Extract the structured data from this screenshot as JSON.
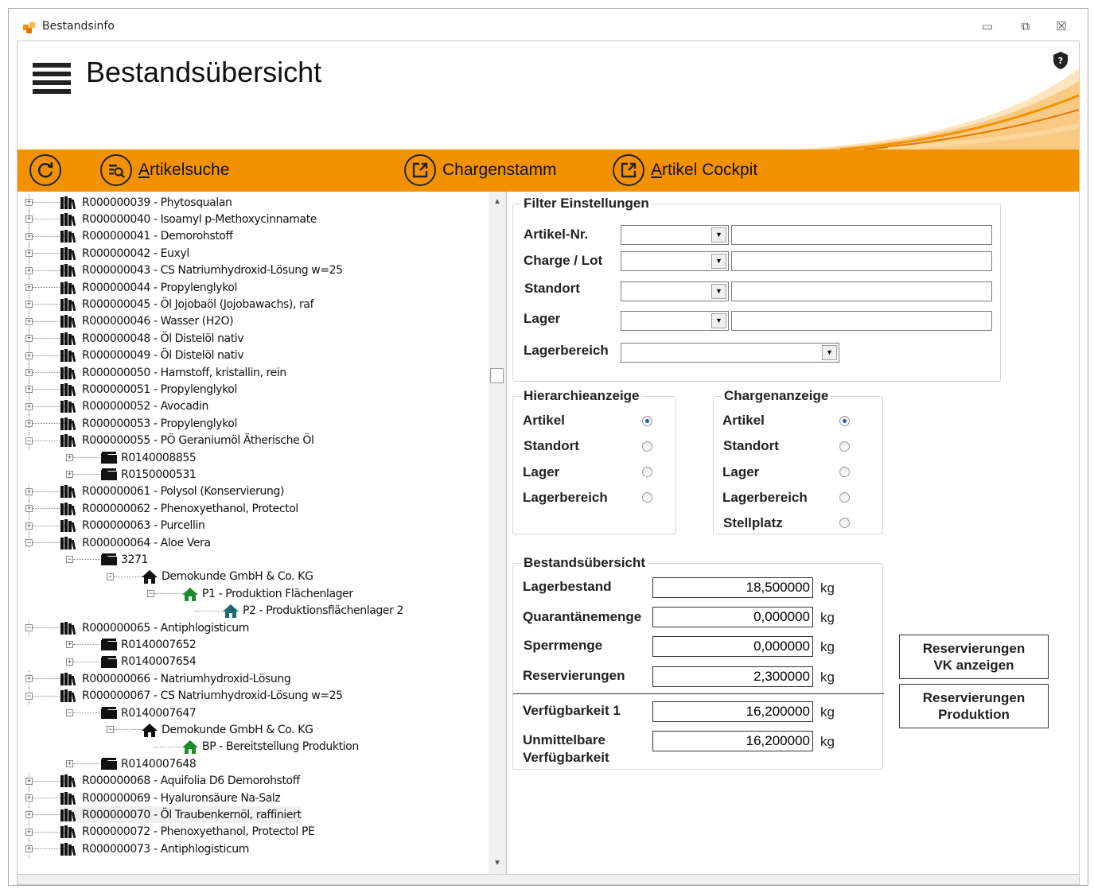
{
  "window": {
    "title": "Bestandsinfo",
    "min_glyph": "▭",
    "max_glyph": "⧉",
    "close_glyph": "☒"
  },
  "header": {
    "title": "Bestandsübersicht"
  },
  "toolbar": {
    "accent_color": "#f39200",
    "items": [
      {
        "id": "refresh",
        "label": "",
        "icon": "refresh-icon"
      },
      {
        "id": "artikelsuche",
        "label_ul": "A",
        "label_rest": "rtikelsuche",
        "icon": "search-list-icon"
      },
      {
        "id": "chargenstamm",
        "label": "Chargenstamm",
        "icon": "external-link-icon"
      },
      {
        "id": "cockpit",
        "label_ul": "A",
        "label_rest": "rtikel Cockpit",
        "icon": "external-link-icon"
      }
    ]
  },
  "tree": {
    "rows": [
      {
        "level": 0,
        "expander": "+",
        "icon": "books",
        "text": "R000000039 - Phytosqualan"
      },
      {
        "level": 0,
        "expander": "+",
        "icon": "books",
        "text": "R000000040 - Isoamyl p-Methoxycinnamate"
      },
      {
        "level": 0,
        "expander": "+",
        "icon": "books",
        "text": "R000000041 - Demorohstoff"
      },
      {
        "level": 0,
        "expander": "+",
        "icon": "books",
        "text": "R000000042 - Euxyl"
      },
      {
        "level": 0,
        "expander": "+",
        "icon": "books",
        "text": "R000000043 - CS Natriumhydroxid-Lösung w=25"
      },
      {
        "level": 0,
        "expander": "+",
        "icon": "books",
        "text": "R000000044 - Propylenglykol"
      },
      {
        "level": 0,
        "expander": "+",
        "icon": "books",
        "text": "R000000045 - Öl Jojobaöl (Jojobawachs), raf"
      },
      {
        "level": 0,
        "expander": "+",
        "icon": "books",
        "text": "R000000046 - Wasser (H2O)"
      },
      {
        "level": 0,
        "expander": "+",
        "icon": "books",
        "text": "R000000048 - Öl Distelöl nativ"
      },
      {
        "level": 0,
        "expander": "+",
        "icon": "books",
        "text": "R000000049 - Öl Distelöl nativ"
      },
      {
        "level": 0,
        "expander": "+",
        "icon": "books",
        "text": "R000000050 - Harnstoff, kristallin, rein"
      },
      {
        "level": 0,
        "expander": "+",
        "icon": "books",
        "text": "R000000051 - Propylenglykol"
      },
      {
        "level": 0,
        "expander": "+",
        "icon": "books",
        "text": "R000000052 - Avocadin"
      },
      {
        "level": 0,
        "expander": "+",
        "icon": "books",
        "text": "R000000053 - Propylenglykol"
      },
      {
        "level": 0,
        "expander": "-",
        "icon": "books",
        "text": "R000000055 - PÖ Geraniumöl Ätherische Öl"
      },
      {
        "level": 1,
        "expander": "+",
        "icon": "folder",
        "text": "R0140008855"
      },
      {
        "level": 1,
        "expander": "+",
        "icon": "folder",
        "text": "R0150000531"
      },
      {
        "level": 0,
        "expander": "+",
        "icon": "books",
        "text": "R000000061 - Polysol (Konservierung)"
      },
      {
        "level": 0,
        "expander": "+",
        "icon": "books",
        "text": "R000000062 - Phenoxyethanol, Protectol"
      },
      {
        "level": 0,
        "expander": "+",
        "icon": "books",
        "text": "R000000063 - Purcellin"
      },
      {
        "level": 0,
        "expander": "-",
        "icon": "books",
        "text": "R000000064 - Aloe Vera"
      },
      {
        "level": 1,
        "expander": "-",
        "icon": "folder",
        "text": "3271"
      },
      {
        "level": 2,
        "expander": "-",
        "icon": "house-black",
        "text": "Demokunde GmbH & Co. KG"
      },
      {
        "level": 3,
        "expander": "-",
        "icon": "house-green",
        "text": "P1 - Produktion Flächenlager"
      },
      {
        "level": 4,
        "expander": "",
        "icon": "house-teal",
        "text": "P2 - Produktionsflächenlager 2"
      },
      {
        "level": 0,
        "expander": "-",
        "icon": "books",
        "text": "R000000065 - Antiphlogisticum"
      },
      {
        "level": 1,
        "expander": "+",
        "icon": "folder",
        "text": "R0140007652"
      },
      {
        "level": 1,
        "expander": "+",
        "icon": "folder",
        "text": "R0140007654"
      },
      {
        "level": 0,
        "expander": "+",
        "icon": "books",
        "text": "R000000066 - Natriumhydroxid-Lösung"
      },
      {
        "level": 0,
        "expander": "-",
        "icon": "books",
        "text": "R000000067 - CS Natriumhydroxid-Lösung w=25"
      },
      {
        "level": 1,
        "expander": "-",
        "icon": "folder",
        "text": "R0140007647"
      },
      {
        "level": 2,
        "expander": "-",
        "icon": "house-black",
        "text": "Demokunde GmbH & Co. KG"
      },
      {
        "level": 3,
        "expander": "",
        "icon": "house-green",
        "text": "BP - Bereitstellung Produktion"
      },
      {
        "level": 1,
        "expander": "+",
        "icon": "folder",
        "text": "R0140007648"
      },
      {
        "level": 0,
        "expander": "+",
        "icon": "books",
        "text": "R000000068 - Aquifolia D6 Demorohstoff"
      },
      {
        "level": 0,
        "expander": "+",
        "icon": "books",
        "text": "R000000069 - Hyaluronsäure Na-Salz"
      },
      {
        "level": 0,
        "expander": "+",
        "icon": "books",
        "text": "R000000070 - Öl Traubenkernöl, raffiniert",
        "selected": true
      },
      {
        "level": 0,
        "expander": "+",
        "icon": "books",
        "text": "R000000072 - Phenoxyethanol, Protectol PE"
      },
      {
        "level": 0,
        "expander": "+",
        "icon": "books",
        "text": "R000000073 - Antiphlogisticum"
      }
    ]
  },
  "filter": {
    "title": "Filter Einstellungen",
    "artikel_label": "Artikel-Nr.",
    "charge_label": "Charge / Lot",
    "standort_label": "Standort",
    "lager_label": "Lager",
    "lagerbereich_label": "Lagerbereich"
  },
  "hierarchie": {
    "title": "Hierarchieanzeige",
    "options": [
      "Artikel",
      "Standort",
      "Lager",
      "Lagerbereich"
    ],
    "selected": "Artikel"
  },
  "chargen": {
    "title": "Chargenanzeige",
    "options": [
      "Artikel",
      "Standort",
      "Lager",
      "Lagerbereich",
      "Stellplatz"
    ],
    "selected": "Artikel"
  },
  "bestand": {
    "title": "Bestandsübersicht",
    "lagerbestand_label": "Lagerbestand",
    "lagerbestand_value": "18,500000",
    "quarantaene_label": "Quarantänemenge",
    "quarantaene_value": "0,000000",
    "sperr_label": "Sperrmenge",
    "sperr_value": "0,000000",
    "reserv_label": "Reservierungen",
    "reserv_value": "2,300000",
    "verf1_label": "Verfügbarkeit 1",
    "verf1_value": "16,200000",
    "unmittel_label_1": "Unmittelbare",
    "unmittel_label_2": "Verfügbarkeit",
    "unmittel_value": "16,200000",
    "unit": "kg"
  },
  "buttons": {
    "reserv_vk_1": "Reservierungen",
    "reserv_vk_2": "VK anzeigen",
    "reserv_prod_1": "Reservierungen",
    "reserv_prod_2": "Produktion"
  }
}
